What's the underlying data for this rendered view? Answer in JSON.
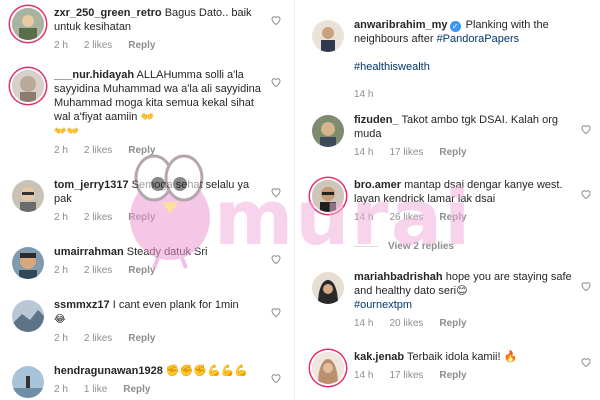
{
  "left": [
    {
      "user": "zxr_250_green_retro",
      "text": "Bagus Dato.. baik untuk kesihatan",
      "time": "2 h",
      "likes": "2 likes",
      "reply": "Reply"
    },
    {
      "user": "___nur.hidayah",
      "text": "ALLAHumma solli a'la sayyidina Muhammad wa a'la ali sayyidina Muhammad moga kita semua kekal sihat wal a'fiyat aamiin 👐",
      "emoji2": "👐👐",
      "time": "2 h",
      "likes": "2 likes",
      "reply": "Reply"
    },
    {
      "user": "tom_jerry1317",
      "text": "Semoga sehat selalu ya pak",
      "time": "2 h",
      "likes": "2 likes",
      "reply": "Reply"
    },
    {
      "user": "umairrahman",
      "text": "Steady datuk Sri",
      "time": "2 h",
      "likes": "2 likes",
      "reply": "Reply"
    },
    {
      "user": "ssmmxz17",
      "text": "I cant even plank for 1min",
      "emoji2": "😂",
      "time": "2 h",
      "likes": "2 likes",
      "reply": "Reply"
    },
    {
      "user": "hendragunawan1928",
      "text": "✊✊✊💪💪💪",
      "time": "2 h",
      "likes": "1 like",
      "reply": "Reply"
    }
  ],
  "post": {
    "user": "anwaribrahim_my",
    "caption": "Planking with the neighbours after",
    "mention": "#PandoraPapers",
    "hashtag": "#healthiswealth",
    "time": "14 h"
  },
  "right": [
    {
      "user": "fizuden_",
      "text": "Takot ambo tgk DSAI. Kalah org muda",
      "time": "14 h",
      "likes": "17 likes",
      "reply": "Reply"
    },
    {
      "user": "bro.amer",
      "text": "mantap dsai dengar kanye west. layan kendrick lamar lak dsai",
      "time": "14 h",
      "likes": "26 likes",
      "reply": "Reply",
      "views": "View 2 replies"
    },
    {
      "user": "mariahbadrishah",
      "text": "hope you are staying safe and healthy dato seri😊",
      "hashtag": "#ournextpm",
      "time": "14 h",
      "likes": "20 likes",
      "reply": "Reply"
    },
    {
      "user": "kak.jenab",
      "text": "Terbaik idola kamii! 🔥",
      "time": "14 h",
      "likes": "17 likes",
      "reply": "Reply"
    }
  ],
  "watermark": {
    "text": "murai"
  },
  "colors": {
    "link": "#00376b",
    "meta": "#8e8e8e",
    "verified": "#3897f0",
    "watermark": "#f3b1dd"
  }
}
